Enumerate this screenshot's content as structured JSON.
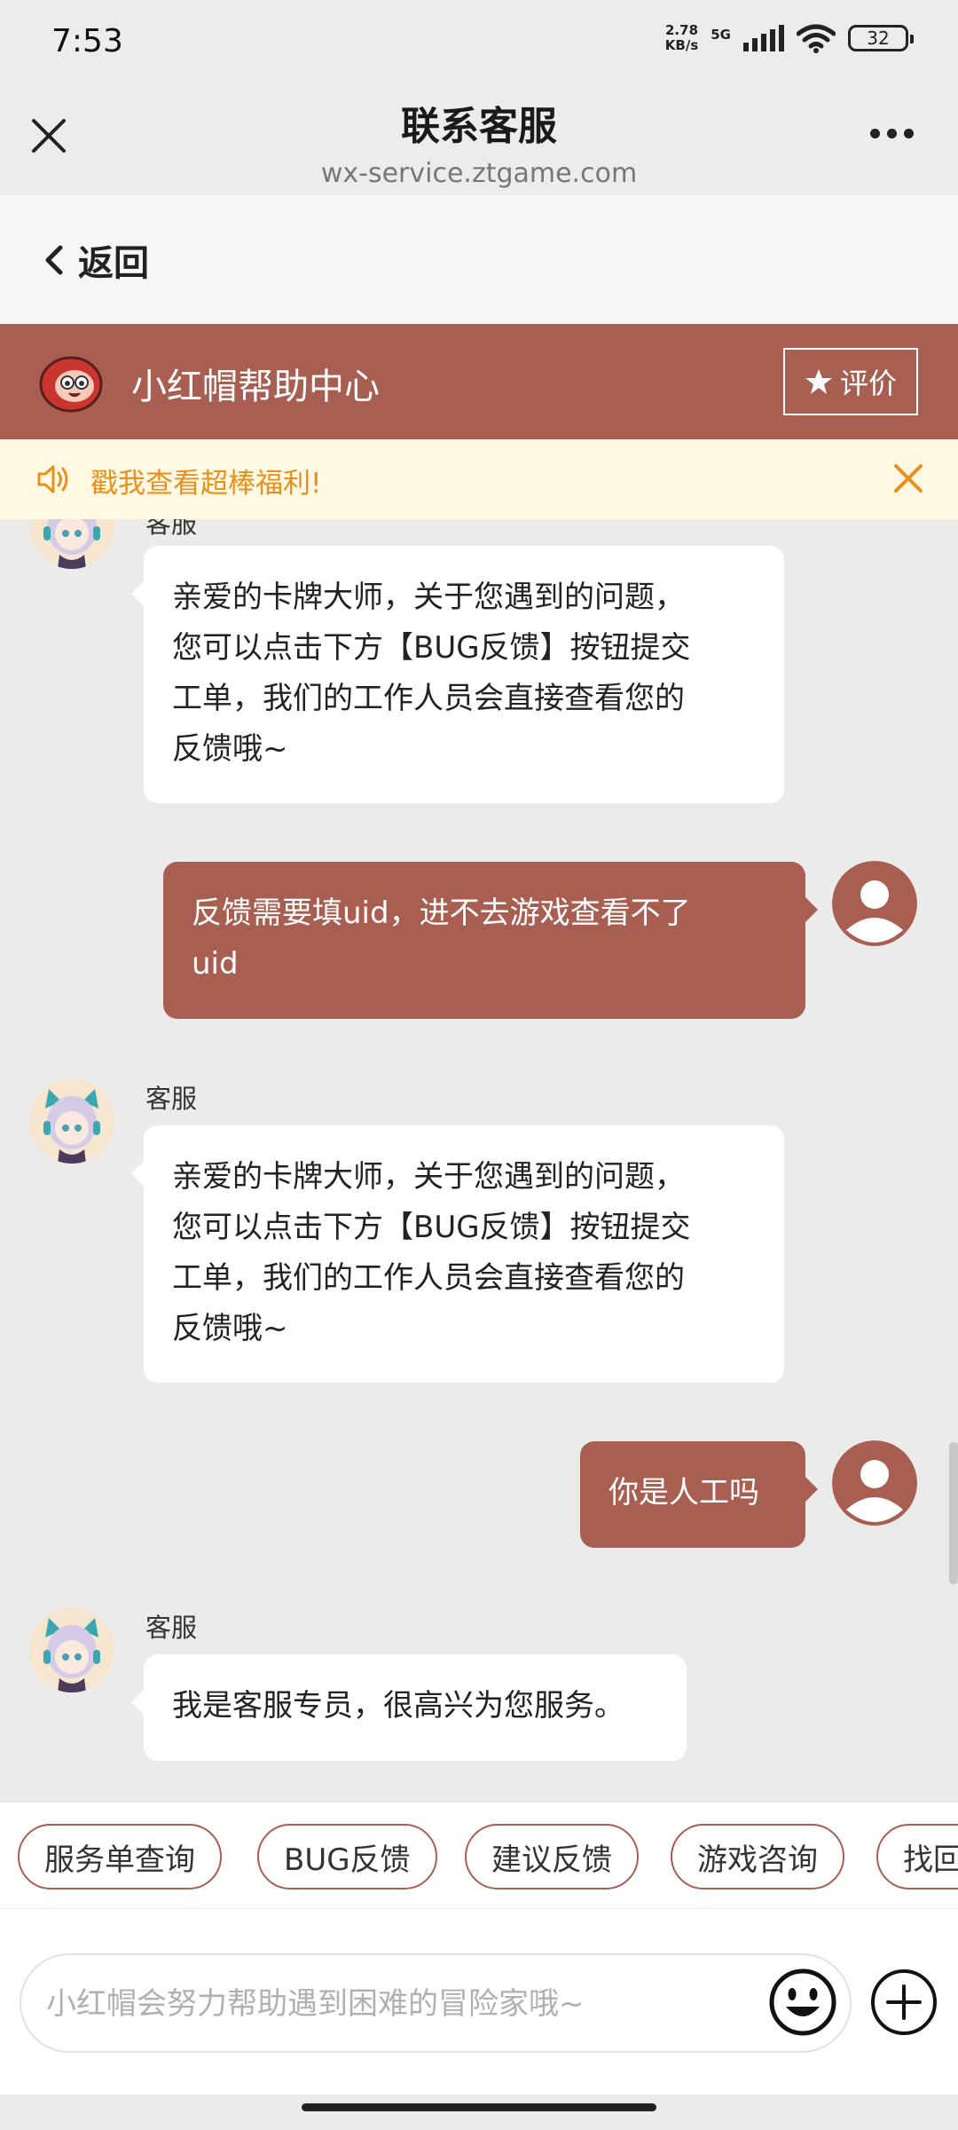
{
  "status_bar": {
    "time": "7:53",
    "net_speed_value": "2.78",
    "net_speed_unit": "KB/s",
    "network_type": "5G",
    "battery": "32"
  },
  "header": {
    "title": "联系客服",
    "url": "wx-service.ztgame.com"
  },
  "back": {
    "label": "返回"
  },
  "brand": {
    "name": "小红帽帮助中心",
    "rate_label": "评价",
    "color": "#a85f51"
  },
  "notice": {
    "text": "戳我查看超棒福利!",
    "color": "#e8901e"
  },
  "chat": {
    "agent_name": "客服",
    "messages": [
      {
        "from": "agent",
        "sender": "客服",
        "lines": [
          "亲爱的卡牌大师，关于您遇到的问题，",
          "您可以点击下方【BUG反馈】按钮提交",
          "工单，我们的工作人员会直接查看您的",
          "反馈哦~"
        ]
      },
      {
        "from": "user",
        "lines": [
          "反馈需要填uid，进不去游戏查看不了",
          "uid"
        ]
      },
      {
        "from": "agent",
        "sender": "客服",
        "lines": [
          "亲爱的卡牌大师，关于您遇到的问题，",
          "您可以点击下方【BUG反馈】按钮提交",
          "工单，我们的工作人员会直接查看您的",
          "反馈哦~"
        ]
      },
      {
        "from": "user",
        "lines": [
          "你是人工吗"
        ]
      },
      {
        "from": "agent",
        "sender": "客服",
        "lines": [
          "我是客服专员，很高兴为您服务。"
        ]
      }
    ]
  },
  "quick_actions": [
    "服务单查询",
    "BUG反馈",
    "建议反馈",
    "游戏咨询",
    "找回"
  ],
  "input": {
    "placeholder": "小红帽会努力帮助遇到困难的冒险家哦~"
  },
  "icons": {
    "close": "close-icon",
    "more": "more-icon",
    "back": "chevron-left-icon",
    "rate": "star-icon",
    "notice": "speaker-icon",
    "notice_close": "close-icon",
    "emoji": "emoji-icon",
    "plus": "plus-icon"
  }
}
